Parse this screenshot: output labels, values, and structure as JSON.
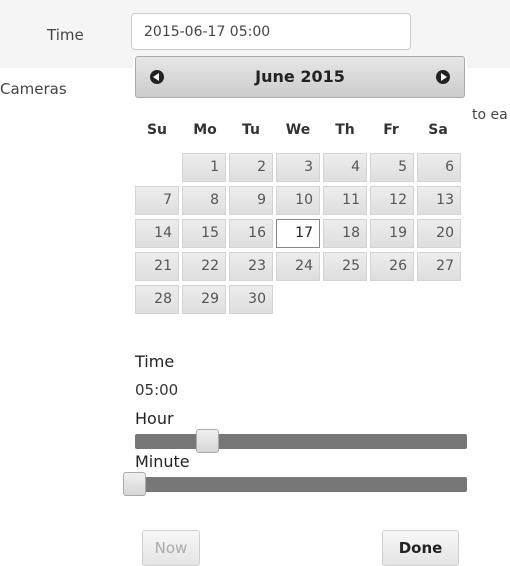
{
  "form": {
    "time_label": "Time",
    "time_value": "2015-06-17 05:00",
    "cameras_label": "Cameras",
    "trailing_text": "to ea"
  },
  "picker": {
    "month_title": "June 2015",
    "weekdays": [
      "Su",
      "Mo",
      "Tu",
      "We",
      "Th",
      "Fr",
      "Sa"
    ],
    "days": [
      "1",
      "2",
      "3",
      "4",
      "5",
      "6",
      "7",
      "8",
      "9",
      "10",
      "11",
      "12",
      "13",
      "14",
      "15",
      "16",
      "17",
      "18",
      "19",
      "20",
      "21",
      "22",
      "23",
      "24",
      "25",
      "26",
      "27",
      "28",
      "29",
      "30"
    ],
    "selected_day": "17",
    "time_heading": "Time",
    "time_value": "05:00",
    "hour_label": "Hour",
    "hour_value": 5,
    "minute_label": "Minute",
    "minute_value": 0,
    "now_label": "Now",
    "done_label": "Done"
  },
  "icons": {
    "prev": "circle-arrow-left-icon",
    "next": "circle-arrow-right-icon"
  }
}
